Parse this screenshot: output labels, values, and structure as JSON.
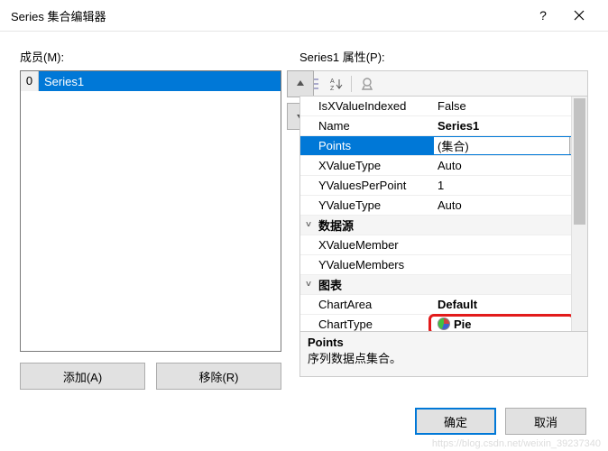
{
  "window": {
    "title": "Series 集合编辑器",
    "help": "?",
    "close": "×"
  },
  "left": {
    "label": "成员(M):",
    "members": [
      {
        "index": "0",
        "name": "Series1"
      }
    ],
    "add_button": "添加(A)",
    "remove_button": "移除(R)"
  },
  "right": {
    "label": "Series1 属性(P):",
    "properties": [
      {
        "type": "row",
        "name": "IsXValueIndexed",
        "value": "False"
      },
      {
        "type": "row",
        "name": "Name",
        "value": "Series1",
        "bold": true
      },
      {
        "type": "row",
        "name": "Points",
        "value": "(集合)",
        "selected": true,
        "ellipsis": true
      },
      {
        "type": "row",
        "name": "XValueType",
        "value": "Auto"
      },
      {
        "type": "row",
        "name": "YValuesPerPoint",
        "value": "1"
      },
      {
        "type": "row",
        "name": "YValueType",
        "value": "Auto"
      },
      {
        "type": "category",
        "name": "数据源"
      },
      {
        "type": "row",
        "name": "XValueMember",
        "value": ""
      },
      {
        "type": "row",
        "name": "YValueMembers",
        "value": ""
      },
      {
        "type": "category",
        "name": "图表"
      },
      {
        "type": "row",
        "name": "ChartArea",
        "value": "Default",
        "bold": true
      },
      {
        "type": "row",
        "name": "ChartType",
        "value": "Pie",
        "bold": true,
        "icon": "pie",
        "highlight": true
      }
    ],
    "description": {
      "title": "Points",
      "text": "序列数据点集合。"
    }
  },
  "footer": {
    "ok": "确定",
    "cancel": "取消"
  },
  "watermark": "https://blog.csdn.net/weixin_39237340"
}
